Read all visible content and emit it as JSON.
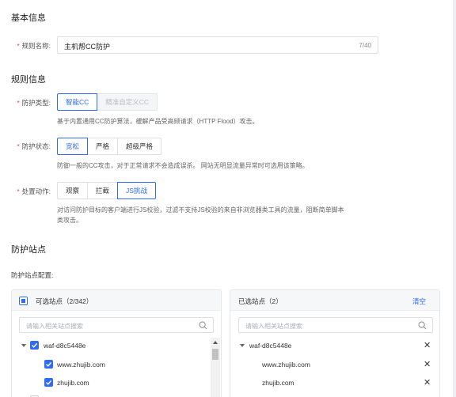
{
  "basic_info": {
    "section_title": "基本信息",
    "rule_name_label": "规则名称:",
    "rule_name_value": "主机帮CC防护",
    "rule_name_count": "7/40"
  },
  "rule_info": {
    "section_title": "规则信息",
    "protection_type": {
      "label": "防护类型:",
      "options": [
        "智能CC",
        "精准自定义CC"
      ],
      "selected": "智能CC",
      "help": "基于内置通用CC防护算法，缓解产品受高频请求（HTTP Flood）攻击。"
    },
    "protection_status": {
      "label": "防护状态:",
      "options": [
        "宽松",
        "严格",
        "超级严格"
      ],
      "selected": "宽松",
      "help": "防御一般的CC攻击，对于正常请求不会造成误杀。 网站无明显流量异常时可选用该策略。"
    },
    "action": {
      "label": "处置动作:",
      "options": [
        "观察",
        "拦截",
        "JS挑战"
      ],
      "selected": "JS挑战",
      "help_line1": "对访问防护目标的客户端进行JS校验，过滤不支持JS校验的来自非浏览器类工具的流量，阻断简单脚本",
      "help_line2": "类攻击。"
    }
  },
  "sites": {
    "section_title": "防护站点",
    "config_label": "防护站点配置:",
    "available": {
      "title": "可选站点（2/342）",
      "search_placeholder": "请输入相关站点搜索",
      "group": "waf-d8c5448e",
      "items": [
        "www.zhujib.com",
        "zhujib.com"
      ]
    },
    "selected": {
      "title": "已选站点（2）",
      "clear_label": "清空",
      "search_placeholder": "请输入相关站点搜索",
      "group": "waf-d8c5448e",
      "items": [
        "www.zhujib.com",
        "zhujib.com"
      ]
    }
  },
  "colors": {
    "accent": "#2e6cf6",
    "required": "#e5484d"
  }
}
